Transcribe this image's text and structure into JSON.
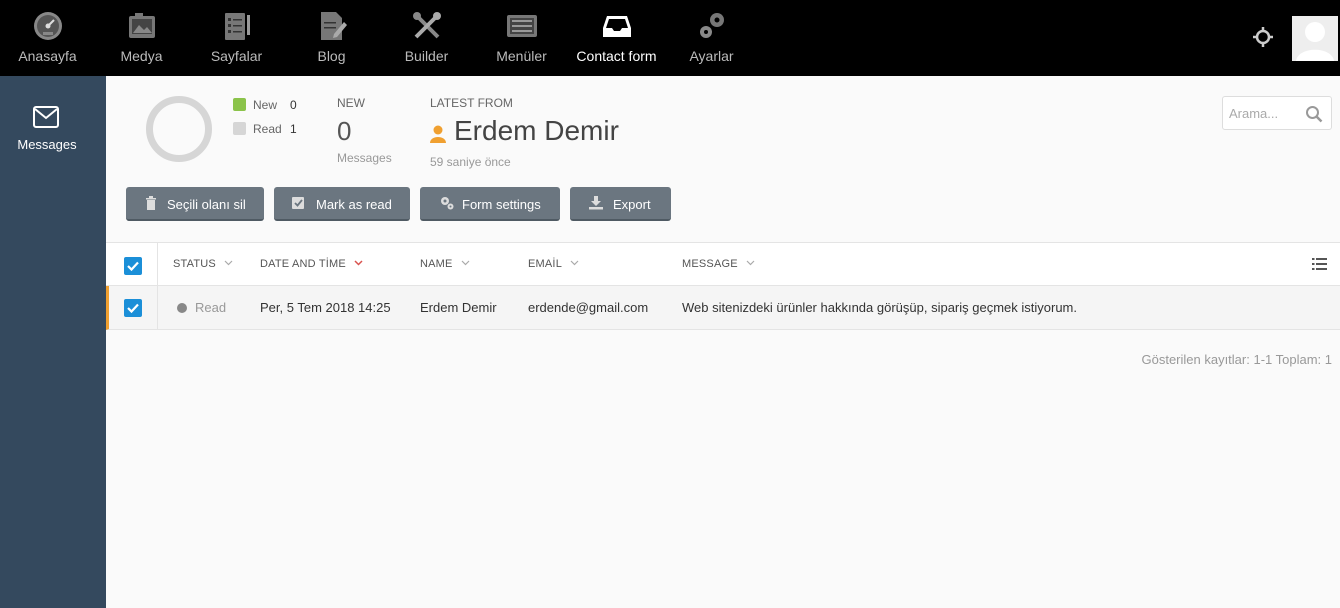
{
  "nav": {
    "items": [
      {
        "label": "Anasayfa",
        "icon": "speedometer-icon"
      },
      {
        "label": "Medya",
        "icon": "media-icon"
      },
      {
        "label": "Sayfalar",
        "icon": "pages-icon"
      },
      {
        "label": "Blog",
        "icon": "blog-icon"
      },
      {
        "label": "Builder",
        "icon": "tools-icon"
      },
      {
        "label": "Menüler",
        "icon": "menu-list-icon"
      },
      {
        "label": "Contact form",
        "icon": "inbox-icon"
      },
      {
        "label": "Ayarlar",
        "icon": "gears-icon"
      }
    ],
    "active": "Contact form"
  },
  "sidebar": {
    "items": [
      {
        "label": "Messages",
        "icon": "envelope-icon"
      }
    ]
  },
  "summary": {
    "legend": [
      {
        "label": "New",
        "count": "0",
        "color": "#8bc34a"
      },
      {
        "label": "Read",
        "count": "1",
        "color": "#d6d6d6"
      }
    ],
    "new_label": "NEW",
    "new_count": "0",
    "new_sub": "Messages",
    "latest_label": "LATEST FROM",
    "latest_name": "Erdem Demir",
    "latest_time": "59 saniye önce"
  },
  "search": {
    "placeholder": "Arama..."
  },
  "toolbar": {
    "delete_label": "Seçili olanı sil",
    "mark_read_label": "Mark as read",
    "form_settings_label": "Form settings",
    "export_label": "Export"
  },
  "table": {
    "headers": {
      "status": "STATUS",
      "date": "DATE AND TİME",
      "name": "NAME",
      "email": "EMAİL",
      "message": "MESSAGE"
    },
    "rows": [
      {
        "status": "Read",
        "date": "Per, 5 Tem 2018 14:25",
        "name": "Erdem Demir",
        "email": "erdende@gmail.com",
        "message": "Web sitenizdeki ürünler hakkında görüşüp, sipariş geçmek istiyorum."
      }
    ]
  },
  "footer": {
    "info": "Gösterilen kayıtlar: 1-1 Toplam: 1"
  },
  "colors": {
    "topbar": "#000000",
    "sidebar": "#34495e",
    "button": "#6b7680",
    "checkbox": "#1b8fd8",
    "row_accent": "#f0a030",
    "sort_active": "#d9534f"
  }
}
